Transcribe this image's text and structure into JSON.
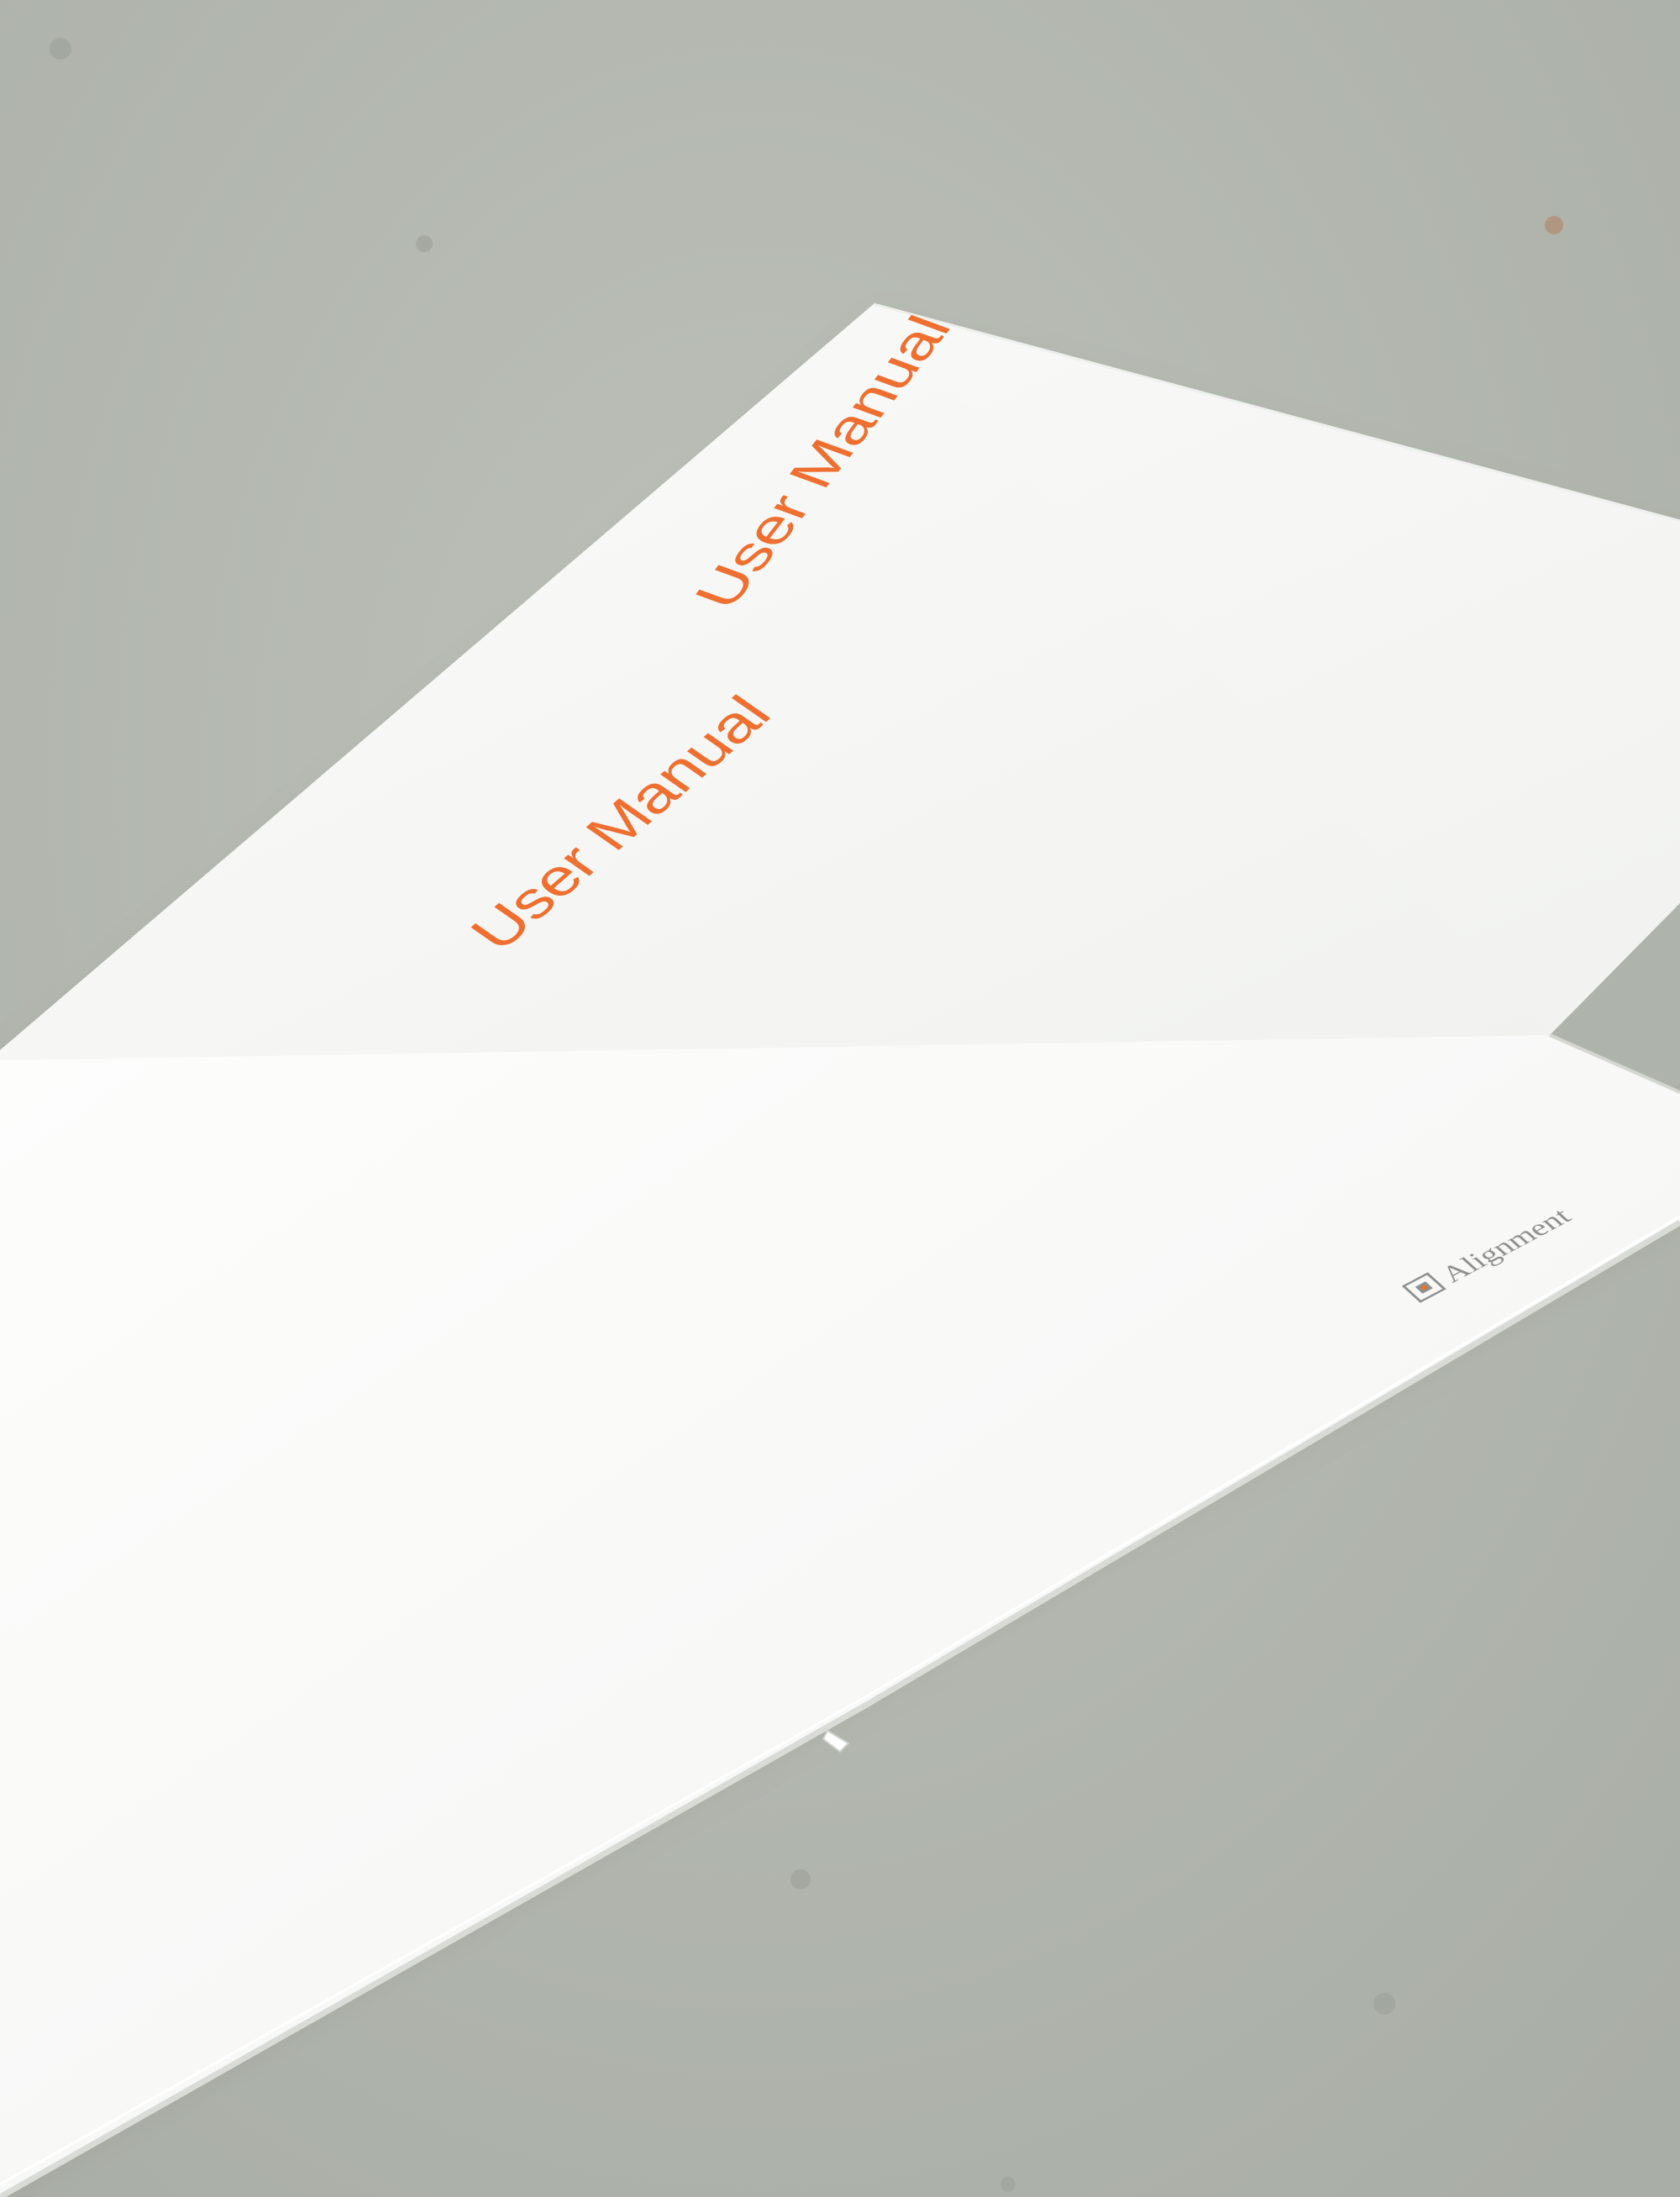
{
  "scene": {
    "description_colors": {
      "background": "#b3b8b0",
      "paper": "#fbfbfa",
      "paper_shadow": "#e6e8e4",
      "title_accent": "#ee6f2f",
      "brand_gray": "#8f918e"
    }
  },
  "back_sheet": {
    "title": "User Manual"
  },
  "front_sheet": {
    "title": "User Manual",
    "brand": {
      "name": "Alignment",
      "icon": "square-dot-logo-icon"
    }
  }
}
